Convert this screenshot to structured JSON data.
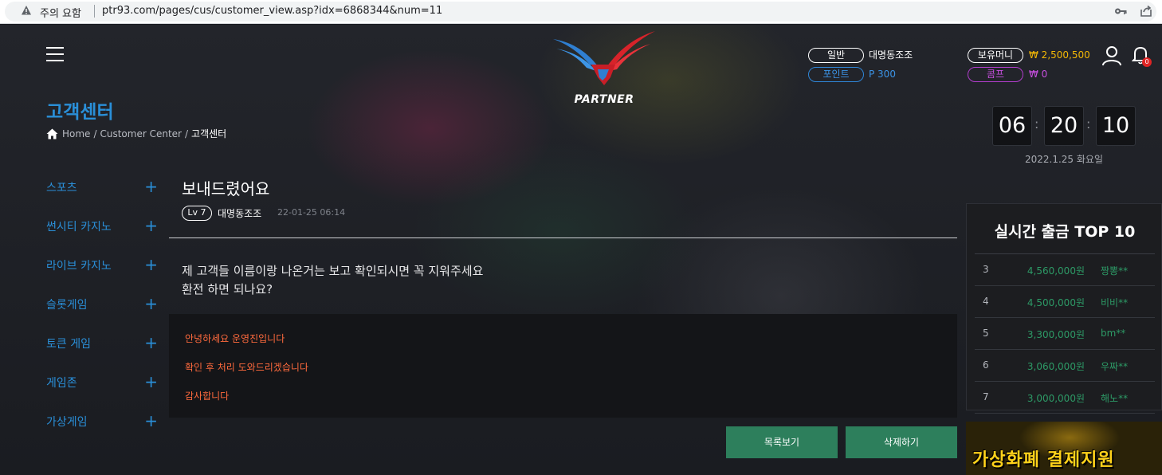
{
  "browser": {
    "warning": "주의 요함",
    "url": "ptr93.com/pages/cus/customer_view.asp?idx=6868344&num=11"
  },
  "header": {
    "logo_text": "PARTNER",
    "grade_label": "일반",
    "username": "대명동조조",
    "points_label": "포인트",
    "points_value": "P 300",
    "money_label": "보유머니",
    "money_value": "₩ 2,500,500",
    "comp_label": "콤프",
    "comp_value": "₩ 0",
    "notification_count": "0",
    "colors": {
      "accent_blue": "#2a8fd8",
      "money_gold": "#f2b705",
      "comp_purple": "#c84fe0",
      "action_green": "#2d7f5c"
    }
  },
  "page": {
    "title": "고객센터",
    "breadcrumb": {
      "home": "Home",
      "section": "Customer Center",
      "current": "고객센터",
      "sep": "/"
    }
  },
  "sidebar": {
    "items": [
      {
        "label": "스포츠"
      },
      {
        "label": "썬시티 카지노"
      },
      {
        "label": "라이브 카지노"
      },
      {
        "label": "슬롯게임"
      },
      {
        "label": "토큰 게임"
      },
      {
        "label": "게임존"
      },
      {
        "label": "가상게임"
      }
    ],
    "plus": "+"
  },
  "post": {
    "title": "보내드렸어요",
    "level": "Lv 7",
    "author": "대명동조조",
    "date": "22-01-25 06:14",
    "body": [
      "제 고객들 이름이랑 나온거는 보고 확인되시면 꼭 지워주세요",
      "환전 하면 되나요?"
    ],
    "reply": [
      "안녕하세요 운영진입니다",
      "확인 후 처리 도와드리겠습니다",
      "감사합니다"
    ]
  },
  "actions": {
    "list_label": "목록보기",
    "delete_label": "삭제하기"
  },
  "clock": {
    "hours": "06",
    "minutes": "20",
    "seconds": "10",
    "sep": ":",
    "date": "2022.1.25 화요일"
  },
  "top10": {
    "title": "실시간 출금 TOP 10",
    "rows": [
      {
        "rank": "3",
        "amount": "4,560,000원",
        "name": "짱뽕**"
      },
      {
        "rank": "4",
        "amount": "4,500,000원",
        "name": "비비**"
      },
      {
        "rank": "5",
        "amount": "3,300,000원",
        "name": "bm**"
      },
      {
        "rank": "6",
        "amount": "3,060,000원",
        "name": "우짜**"
      },
      {
        "rank": "7",
        "amount": "3,000,000원",
        "name": "해노**"
      }
    ]
  },
  "banner": {
    "text": "가상화폐 결제지원"
  }
}
